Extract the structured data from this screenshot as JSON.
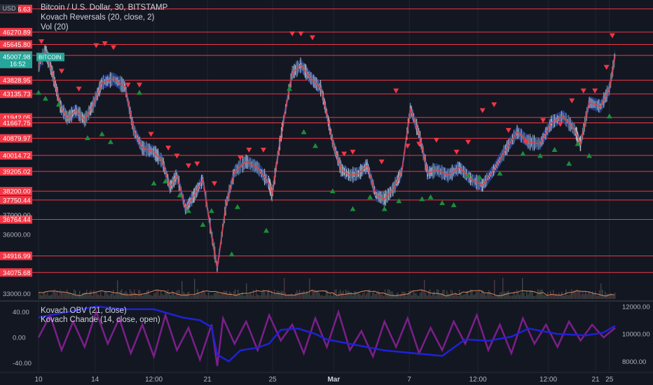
{
  "header": {
    "title": "Bitcoin / U.S. Dollar, 30, BITSTAMP",
    "currency": "USD",
    "indicators": [
      "Kovach Reversals (20, close, 2)",
      "Vol (20)"
    ]
  },
  "lower_pane": {
    "indicators": [
      "Kovach OBV (21, close)",
      "Kovach Chande (14, close, open)"
    ]
  },
  "colors": {
    "background": "#131722",
    "level_line": "#f23645",
    "label_bg": "#f23645",
    "current_price_bg": "#26a69a",
    "down_marker": "#f23645",
    "up_marker": "#1b8e3a",
    "band": "#2a47a8",
    "obv_line": "#1e22d6",
    "chande_line": "#7b1f8a"
  },
  "chart_data": [
    {
      "type": "line",
      "symbol": "BITCOIN",
      "price_axis": {
        "ylim": [
          32700,
          47900
        ],
        "level_labels": [
          "47446.63",
          "46270.89",
          "45645.80",
          "45089.96",
          "43828.95",
          "43135.73",
          "41942.05",
          "41667.75",
          "40879.97",
          "40014.72",
          "39205.02",
          "38200.00",
          "37750.44",
          "36764.44",
          "34916.99",
          "34075.68"
        ],
        "tick_labels": [
          "37000.00",
          "36000.00",
          "33000.00"
        ],
        "current_price": {
          "symbol": "BITCOIN",
          "value": "45007.98",
          "countdown": "16:52"
        }
      },
      "x_axis": {
        "labels": [
          "10",
          "14",
          "12:00",
          "21",
          "25",
          "Mar",
          "7",
          "12:00",
          "12:00",
          "21",
          "25"
        ],
        "label_fractions": [
          0.0,
          0.098,
          0.2,
          0.293,
          0.406,
          0.512,
          0.643,
          0.762,
          0.884,
          0.966,
          0.99
        ]
      },
      "price_path": [
        [
          0.0,
          44600
        ],
        [
          0.012,
          45300
        ],
        [
          0.025,
          44100
        ],
        [
          0.038,
          42500
        ],
        [
          0.05,
          41900
        ],
        [
          0.065,
          42300
        ],
        [
          0.08,
          41800
        ],
        [
          0.095,
          42600
        ],
        [
          0.11,
          43700
        ],
        [
          0.13,
          43900
        ],
        [
          0.15,
          43500
        ],
        [
          0.165,
          41300
        ],
        [
          0.18,
          40400
        ],
        [
          0.2,
          40200
        ],
        [
          0.215,
          39700
        ],
        [
          0.228,
          38400
        ],
        [
          0.24,
          39000
        ],
        [
          0.255,
          37300
        ],
        [
          0.27,
          38000
        ],
        [
          0.285,
          38800
        ],
        [
          0.3,
          36000
        ],
        [
          0.31,
          34300
        ],
        [
          0.325,
          37500
        ],
        [
          0.34,
          39200
        ],
        [
          0.36,
          39700
        ],
        [
          0.38,
          39400
        ],
        [
          0.4,
          38600
        ],
        [
          0.405,
          38000
        ],
        [
          0.415,
          40000
        ],
        [
          0.425,
          41800
        ],
        [
          0.44,
          44200
        ],
        [
          0.455,
          44600
        ],
        [
          0.47,
          44000
        ],
        [
          0.49,
          43400
        ],
        [
          0.5,
          42100
        ],
        [
          0.51,
          40700
        ],
        [
          0.525,
          39300
        ],
        [
          0.54,
          39000
        ],
        [
          0.555,
          39100
        ],
        [
          0.57,
          39500
        ],
        [
          0.585,
          38000
        ],
        [
          0.6,
          37800
        ],
        [
          0.615,
          38300
        ],
        [
          0.63,
          39200
        ],
        [
          0.645,
          42400
        ],
        [
          0.66,
          41100
        ],
        [
          0.675,
          39100
        ],
        [
          0.69,
          39300
        ],
        [
          0.71,
          39000
        ],
        [
          0.73,
          39400
        ],
        [
          0.75,
          38800
        ],
        [
          0.77,
          38500
        ],
        [
          0.79,
          39300
        ],
        [
          0.81,
          40300
        ],
        [
          0.83,
          41200
        ],
        [
          0.85,
          40700
        ],
        [
          0.87,
          40600
        ],
        [
          0.89,
          41700
        ],
        [
          0.91,
          42000
        ],
        [
          0.93,
          41300
        ],
        [
          0.94,
          40600
        ],
        [
          0.955,
          42700
        ],
        [
          0.975,
          42500
        ],
        [
          0.99,
          43400
        ],
        [
          1.0,
          45100
        ]
      ],
      "reversal_markers": {
        "down": [
          [
            0.005,
            45800
          ],
          [
            0.04,
            44300
          ],
          [
            0.07,
            43400
          ],
          [
            0.1,
            45600
          ],
          [
            0.115,
            45700
          ],
          [
            0.13,
            45500
          ],
          [
            0.155,
            43600
          ],
          [
            0.175,
            43600
          ],
          [
            0.195,
            41100
          ],
          [
            0.225,
            40400
          ],
          [
            0.24,
            40000
          ],
          [
            0.26,
            39500
          ],
          [
            0.275,
            39600
          ],
          [
            0.305,
            38600
          ],
          [
            0.35,
            39900
          ],
          [
            0.365,
            40300
          ],
          [
            0.39,
            40300
          ],
          [
            0.44,
            46200
          ],
          [
            0.455,
            46200
          ],
          [
            0.475,
            46000
          ],
          [
            0.53,
            40100
          ],
          [
            0.545,
            40200
          ],
          [
            0.595,
            39700
          ],
          [
            0.62,
            43300
          ],
          [
            0.64,
            40500
          ],
          [
            0.66,
            40600
          ],
          [
            0.69,
            40800
          ],
          [
            0.725,
            40200
          ],
          [
            0.745,
            40700
          ],
          [
            0.77,
            42300
          ],
          [
            0.79,
            42600
          ],
          [
            0.815,
            41300
          ],
          [
            0.845,
            40700
          ],
          [
            0.875,
            41800
          ],
          [
            0.905,
            41600
          ],
          [
            0.925,
            42800
          ],
          [
            0.945,
            43300
          ],
          [
            0.965,
            43300
          ],
          [
            0.985,
            44500
          ],
          [
            0.995,
            46100
          ]
        ],
        "up": [
          [
            0.0,
            43200
          ],
          [
            0.012,
            42900
          ],
          [
            0.035,
            42600
          ],
          [
            0.085,
            40900
          ],
          [
            0.11,
            41100
          ],
          [
            0.125,
            40700
          ],
          [
            0.175,
            43200
          ],
          [
            0.2,
            38600
          ],
          [
            0.22,
            38700
          ],
          [
            0.245,
            38000
          ],
          [
            0.26,
            37200
          ],
          [
            0.285,
            36500
          ],
          [
            0.3,
            37200
          ],
          [
            0.335,
            35000
          ],
          [
            0.345,
            37400
          ],
          [
            0.395,
            36200
          ],
          [
            0.435,
            43400
          ],
          [
            0.46,
            41200
          ],
          [
            0.48,
            40500
          ],
          [
            0.51,
            38200
          ],
          [
            0.545,
            37300
          ],
          [
            0.575,
            37900
          ],
          [
            0.6,
            37300
          ],
          [
            0.625,
            37700
          ],
          [
            0.665,
            37800
          ],
          [
            0.68,
            37900
          ],
          [
            0.7,
            37600
          ],
          [
            0.72,
            37500
          ],
          [
            0.745,
            39000
          ],
          [
            0.765,
            38900
          ],
          [
            0.8,
            39100
          ],
          [
            0.84,
            40100
          ],
          [
            0.87,
            40000
          ],
          [
            0.895,
            40300
          ],
          [
            0.92,
            39600
          ],
          [
            0.935,
            40600
          ],
          [
            0.955,
            40000
          ],
          [
            0.99,
            42000
          ]
        ]
      }
    },
    {
      "type": "line",
      "series": [
        {
          "name": "Kovach OBV (21, close)",
          "axis": "right",
          "values": [
            [
              0.0,
              11200
            ],
            [
              0.05,
              11600
            ],
            [
              0.1,
              12000
            ],
            [
              0.15,
              11800
            ],
            [
              0.2,
              11800
            ],
            [
              0.25,
              11200
            ],
            [
              0.28,
              11000
            ],
            [
              0.3,
              10500
            ],
            [
              0.31,
              8500
            ],
            [
              0.33,
              8000
            ],
            [
              0.35,
              8800
            ],
            [
              0.38,
              9000
            ],
            [
              0.4,
              9300
            ],
            [
              0.42,
              10300
            ],
            [
              0.45,
              10400
            ],
            [
              0.48,
              10000
            ],
            [
              0.5,
              9600
            ],
            [
              0.55,
              9200
            ],
            [
              0.6,
              8800
            ],
            [
              0.65,
              8600
            ],
            [
              0.7,
              8400
            ],
            [
              0.72,
              9000
            ],
            [
              0.74,
              9600
            ],
            [
              0.78,
              9500
            ],
            [
              0.82,
              9800
            ],
            [
              0.85,
              10400
            ],
            [
              0.9,
              10000
            ],
            [
              0.95,
              9900
            ],
            [
              0.98,
              10100
            ],
            [
              1.0,
              10600
            ]
          ]
        },
        {
          "name": "Kovach Chande (14, close, open)",
          "axis": "left",
          "values": [
            [
              0.0,
              0
            ],
            [
              0.02,
              35
            ],
            [
              0.04,
              -20
            ],
            [
              0.06,
              25
            ],
            [
              0.08,
              -15
            ],
            [
              0.1,
              40
            ],
            [
              0.12,
              -10
            ],
            [
              0.14,
              30
            ],
            [
              0.16,
              -25
            ],
            [
              0.18,
              20
            ],
            [
              0.2,
              -30
            ],
            [
              0.22,
              35
            ],
            [
              0.24,
              -20
            ],
            [
              0.26,
              15
            ],
            [
              0.28,
              -35
            ],
            [
              0.3,
              20
            ],
            [
              0.31,
              -45
            ],
            [
              0.32,
              30
            ],
            [
              0.34,
              -10
            ],
            [
              0.36,
              25
            ],
            [
              0.38,
              -20
            ],
            [
              0.4,
              35
            ],
            [
              0.42,
              -5
            ],
            [
              0.44,
              20
            ],
            [
              0.46,
              -25
            ],
            [
              0.48,
              30
            ],
            [
              0.5,
              -15
            ],
            [
              0.52,
              40
            ],
            [
              0.54,
              -20
            ],
            [
              0.56,
              10
            ],
            [
              0.58,
              -30
            ],
            [
              0.6,
              25
            ],
            [
              0.62,
              -15
            ],
            [
              0.64,
              30
            ],
            [
              0.66,
              -25
            ],
            [
              0.68,
              15
            ],
            [
              0.7,
              -20
            ],
            [
              0.72,
              25
            ],
            [
              0.74,
              -10
            ],
            [
              0.76,
              35
            ],
            [
              0.78,
              -20
            ],
            [
              0.8,
              20
            ],
            [
              0.82,
              -25
            ],
            [
              0.84,
              30
            ],
            [
              0.86,
              -10
            ],
            [
              0.88,
              20
            ],
            [
              0.9,
              -15
            ],
            [
              0.92,
              25
            ],
            [
              0.94,
              -5
            ],
            [
              0.96,
              20
            ],
            [
              0.98,
              0
            ],
            [
              1.0,
              15
            ]
          ]
        }
      ],
      "left_axis": {
        "ylim": [
          -55,
          55
        ],
        "tick_labels": [
          "40.00",
          "0.00",
          "-40.00"
        ]
      },
      "right_axis": {
        "ylim": [
          7200,
          12300
        ],
        "tick_labels": [
          "12000.00",
          "10000.00",
          "8000.00"
        ]
      }
    }
  ]
}
